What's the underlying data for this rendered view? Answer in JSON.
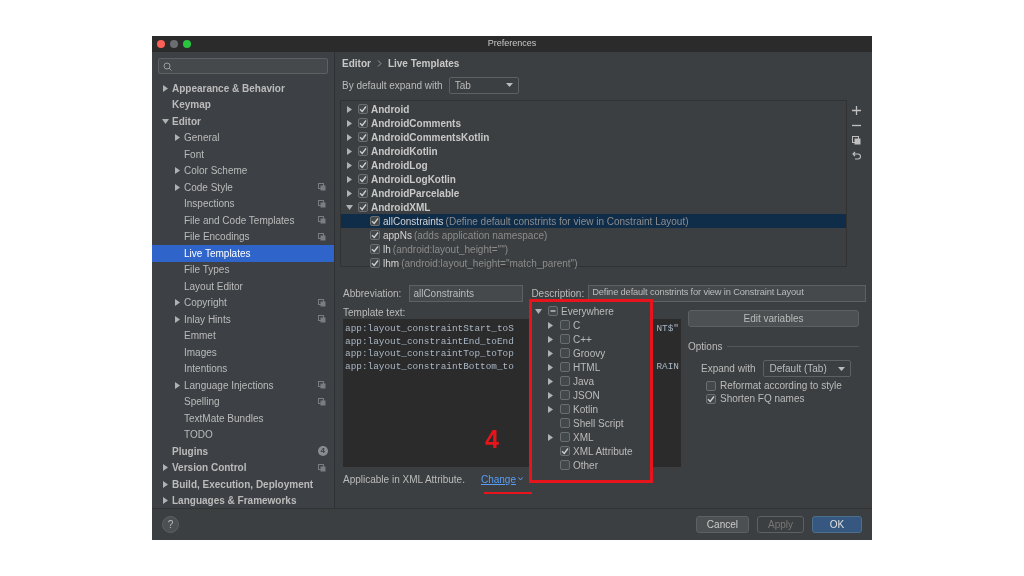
{
  "window": {
    "title": "Preferences"
  },
  "sidebar": {
    "items": [
      {
        "label": "Appearance & Behavior",
        "bold": true,
        "expanded": false,
        "selected": false
      },
      {
        "label": "Keymap",
        "bold": true,
        "selected": false
      },
      {
        "label": "Editor",
        "bold": true,
        "expanded": true,
        "selected": false,
        "children": [
          {
            "label": "General",
            "expanded": false,
            "selected": false
          },
          {
            "label": "Font",
            "selected": false
          },
          {
            "label": "Color Scheme",
            "expanded": false,
            "selected": false
          },
          {
            "label": "Code Style",
            "expanded": false,
            "project_icon": true,
            "selected": false
          },
          {
            "label": "Inspections",
            "project_icon": true,
            "selected": false
          },
          {
            "label": "File and Code Templates",
            "project_icon": true,
            "selected": false
          },
          {
            "label": "File Encodings",
            "project_icon": true,
            "selected": false
          },
          {
            "label": "Live Templates",
            "selected": true
          },
          {
            "label": "File Types",
            "selected": false
          },
          {
            "label": "Layout Editor",
            "selected": false
          },
          {
            "label": "Copyright",
            "expanded": false,
            "project_icon": true,
            "selected": false
          },
          {
            "label": "Inlay Hints",
            "expanded": false,
            "project_icon": true,
            "selected": false
          },
          {
            "label": "Emmet",
            "selected": false
          },
          {
            "label": "Images",
            "selected": false
          },
          {
            "label": "Intentions",
            "selected": false
          },
          {
            "label": "Language Injections",
            "expanded": false,
            "project_icon": true,
            "selected": false
          },
          {
            "label": "Spelling",
            "project_icon": true,
            "selected": false
          },
          {
            "label": "TextMate Bundles",
            "selected": false
          },
          {
            "label": "TODO",
            "selected": false
          }
        ]
      },
      {
        "label": "Plugins",
        "bold": true,
        "badge": "4",
        "selected": false
      },
      {
        "label": "Version Control",
        "bold": true,
        "expanded": false,
        "project_icon": true,
        "selected": false
      },
      {
        "label": "Build, Execution, Deployment",
        "bold": true,
        "expanded": false,
        "selected": false
      },
      {
        "label": "Languages & Frameworks",
        "bold": true,
        "expanded": false,
        "selected": false
      }
    ]
  },
  "breadcrumb": [
    "Editor",
    "Live Templates"
  ],
  "expand_default": {
    "label": "By default expand with",
    "value": "Tab"
  },
  "templates": [
    {
      "group": "Android",
      "checked": true,
      "expanded": false
    },
    {
      "group": "AndroidComments",
      "checked": true,
      "expanded": false
    },
    {
      "group": "AndroidCommentsKotlin",
      "checked": true,
      "expanded": false
    },
    {
      "group": "AndroidKotlin",
      "checked": true,
      "expanded": false
    },
    {
      "group": "AndroidLog",
      "checked": true,
      "expanded": false
    },
    {
      "group": "AndroidLogKotlin",
      "checked": true,
      "expanded": false
    },
    {
      "group": "AndroidParcelable",
      "checked": true,
      "expanded": false
    },
    {
      "group": "AndroidXML",
      "checked": true,
      "expanded": true,
      "children": [
        {
          "abbreviation": "allConstraints",
          "description": "(Define default constrints for view in Constraint Layout)",
          "checked": true,
          "selected": true
        },
        {
          "abbreviation": "appNs",
          "description": "(adds application namespace)",
          "checked": true,
          "selected": false
        },
        {
          "abbreviation": "lh",
          "description": "(android:layout_height=\"\")",
          "checked": true,
          "selected": false
        },
        {
          "abbreviation": "lhm",
          "description": "(android:layout_height=\"match_parent\")",
          "checked": true,
          "selected": false
        }
      ]
    }
  ],
  "abbreviation": {
    "label": "Abbreviation:",
    "value": "allConstraints"
  },
  "description": {
    "label": "Description:",
    "value": "Define default constrints for view in Constraint Layout"
  },
  "template_text": {
    "label": "Template text:",
    "lines": [
      {
        "left": "app:layout_constraintStart_toS",
        "right": "NT$\""
      },
      {
        "left": "app:layout_constraintEnd_toEnd"
      },
      {
        "left": "app:layout_constraintTop_toTop"
      },
      {
        "left": "app:layout_constraintBottom_to",
        "right": "RAIN"
      }
    ]
  },
  "edit_variables": "Edit variables",
  "options": {
    "title": "Options",
    "expand_with": {
      "label": "Expand with",
      "value": "Default (Tab)"
    },
    "checkboxes": [
      {
        "label": "Reformat according to style",
        "checked": false
      },
      {
        "label": "Shorten FQ names",
        "checked": true
      }
    ]
  },
  "context": {
    "text": "Applicable in XML Attribute.",
    "link": "Change"
  },
  "context_popup": [
    {
      "label": "Everywhere",
      "indeterminate": true,
      "expanded": true,
      "children": [
        {
          "label": "C",
          "checked": false,
          "indeterminate": false,
          "expanded": false
        },
        {
          "label": "C++",
          "checked": false,
          "indeterminate": false,
          "expanded": false
        },
        {
          "label": "Groovy",
          "checked": false,
          "indeterminate": false,
          "expanded": false
        },
        {
          "label": "HTML",
          "checked": false,
          "indeterminate": false,
          "expanded": false
        },
        {
          "label": "Java",
          "checked": false,
          "indeterminate": false,
          "expanded": false
        },
        {
          "label": "JSON",
          "checked": false,
          "indeterminate": false,
          "expanded": false
        },
        {
          "label": "Kotlin",
          "checked": false,
          "indeterminate": false,
          "expanded": false
        },
        {
          "label": "Shell Script",
          "checked": false,
          "indeterminate": false
        },
        {
          "label": "XML",
          "checked": false,
          "indeterminate": false,
          "expanded": false
        },
        {
          "label": "XML Attribute",
          "checked": true,
          "indeterminate": false
        },
        {
          "label": "Other",
          "checked": false,
          "indeterminate": false
        }
      ]
    }
  ],
  "annotation": {
    "label": "4"
  },
  "help_button": "?",
  "buttons": [
    {
      "label": "Cancel",
      "primary": false,
      "disabled": false
    },
    {
      "label": "Apply",
      "primary": false,
      "disabled": true
    },
    {
      "label": "OK",
      "primary": true,
      "disabled": false
    }
  ]
}
